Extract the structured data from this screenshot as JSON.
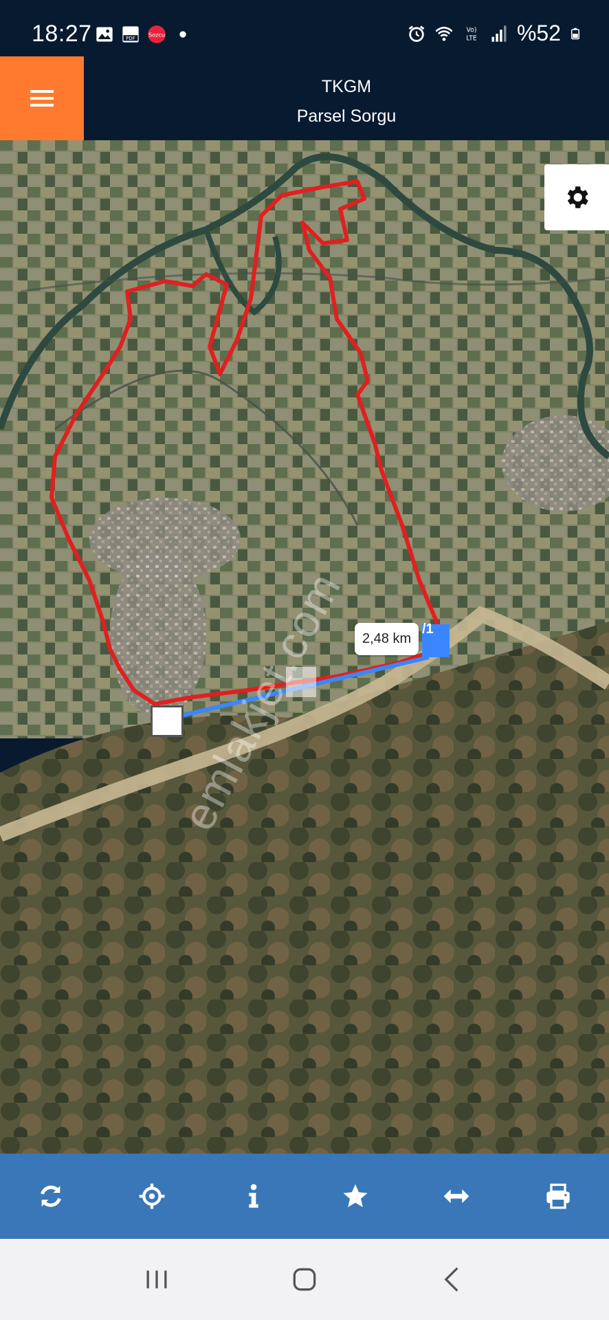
{
  "status_bar": {
    "time": "18:27",
    "battery": "%52",
    "left_icons": [
      "image-icon",
      "pdf-icon",
      "app-notification-icon",
      "dot-icon"
    ],
    "right_icons": [
      "alarm-icon",
      "wifi-icon",
      "volte-icon",
      "signal-icon",
      "battery-icon"
    ]
  },
  "header": {
    "title": "TKGM",
    "subtitle": "Parsel Sorgu",
    "menu_icon": "menu-icon",
    "accent_color": "#ff7a2e",
    "background_color": "#081a30"
  },
  "map": {
    "distance": "2,48 km",
    "parcel_suffix": "/1",
    "watermark": "emlakjet.com",
    "settings_icon": "gear-icon",
    "boundary_color": "#e02020",
    "measure_line_color": "#3a86ff"
  },
  "toolbar": {
    "background_color": "#3a77b8",
    "buttons": [
      {
        "icon": "refresh-icon"
      },
      {
        "icon": "locate-icon"
      },
      {
        "icon": "info-icon"
      },
      {
        "icon": "star-icon"
      },
      {
        "icon": "measure-icon"
      },
      {
        "icon": "print-icon"
      }
    ]
  },
  "navbar": {
    "buttons": [
      {
        "icon": "recent-apps-icon"
      },
      {
        "icon": "home-icon"
      },
      {
        "icon": "back-icon"
      }
    ]
  }
}
